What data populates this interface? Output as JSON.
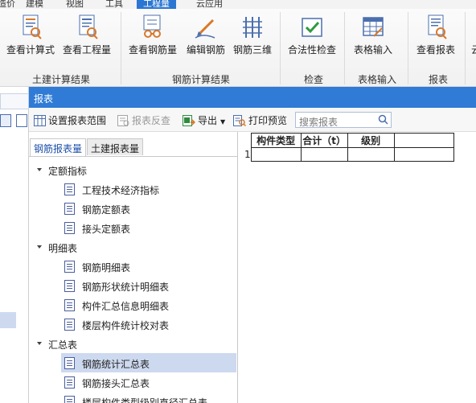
{
  "menubar": {
    "items": [
      "造价",
      "建模",
      "视图",
      "工具",
      "工程量",
      "云应用"
    ],
    "active_index": 4
  },
  "ribbon": {
    "buttons": {
      "view_formula": "查看计算式",
      "view_quantity": "查看工程量",
      "view_rebar_quantity": "查看钢筋量",
      "edit_rebar": "编辑钢筋",
      "rebar_3d": "钢筋三维",
      "legality_check": "合法性检查",
      "table_input": "表格输入",
      "view_report": "查看报表",
      "more_cut": "云"
    },
    "groups": {
      "civil_results": "土建计算结果",
      "rebar_results": "钢筋计算结果",
      "check": "检查",
      "table_input": "表格输入",
      "report": "报表"
    }
  },
  "dialog": {
    "title": "报表",
    "toolbar": {
      "set_range": "设置报表范围",
      "reverse_check": "报表反查",
      "export": "导出",
      "print_preview": "打印预览",
      "search_placeholder": "搜索报表"
    },
    "tabs": [
      "钢筋报表量",
      "土建报表量"
    ],
    "tree": {
      "categories": [
        {
          "label": "定额指标",
          "items": [
            "工程技术经济指标",
            "钢筋定额表",
            "接头定额表"
          ]
        },
        {
          "label": "明细表",
          "items": [
            "钢筋明细表",
            "钢筋形状统计明细表",
            "构件汇总信息明细表",
            "楼层构件统计校对表"
          ]
        },
        {
          "label": "汇总表",
          "items": [
            "钢筋统计汇总表",
            "钢筋接头汇总表",
            "楼层构件类型级别直径汇总表"
          ]
        }
      ],
      "selected": "钢筋统计汇总表"
    },
    "grid": {
      "headers": [
        "构件类型",
        "合计（t）",
        "级别",
        ""
      ],
      "row_number": "1"
    }
  },
  "colors": {
    "title_bar": "#2f7bd6",
    "accent": "#2b76d2",
    "selection": "#cdd9ef"
  }
}
